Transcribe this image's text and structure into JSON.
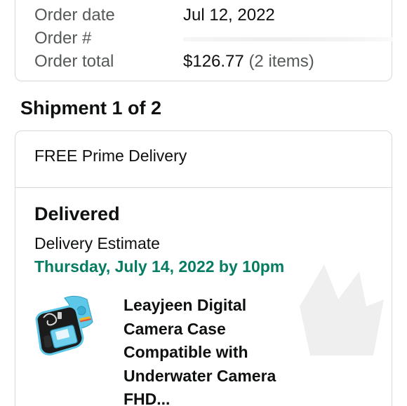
{
  "order_summary": {
    "rows": [
      {
        "label": "Order date",
        "value": "Jul 12, 2022"
      },
      {
        "label": "Order #",
        "value": ""
      },
      {
        "label": "Order total",
        "value": "$126.77",
        "extra": "(2 items)"
      }
    ]
  },
  "shipment": {
    "heading": "Shipment 1 of 2",
    "delivery_type": "FREE Prime Delivery",
    "status": "Delivered",
    "estimate_label": "Delivery Estimate",
    "estimate_date": "Thursday, July 14, 2022 by 10pm",
    "product": {
      "title": "Leayjeen Digital Camera Case Compatible with Underwater Camera FHD...",
      "thumbnail_icon": "camera-case-icon"
    }
  },
  "colors": {
    "border": "#d5d9d9",
    "text": "#0f1111",
    "muted": "#565959",
    "estimate_green": "#067d62"
  }
}
